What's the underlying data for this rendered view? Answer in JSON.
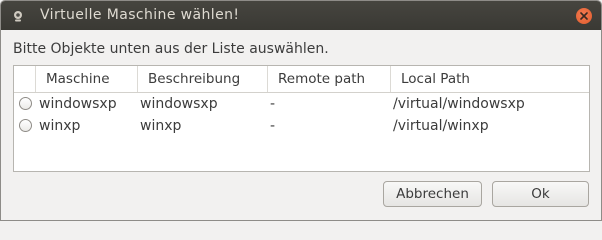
{
  "window": {
    "title": "Virtuelle Maschine wählen!",
    "app_icon": "vm-app-icon",
    "close_icon": "close-icon"
  },
  "instruction": "Bitte Objekte unten aus der Liste auswählen.",
  "table": {
    "columns": [
      "Maschine",
      "Beschreibung",
      "Remote path",
      "Local Path"
    ],
    "rows": [
      {
        "selected": false,
        "machine": "windowsxp",
        "description": "windowsxp",
        "remote_path": "-",
        "local_path": "/virtual/windowsxp"
      },
      {
        "selected": false,
        "machine": "winxp",
        "description": "winxp",
        "remote_path": "-",
        "local_path": "/virtual/winxp"
      }
    ]
  },
  "buttons": {
    "cancel": "Abbrechen",
    "ok": "Ok"
  },
  "colors": {
    "titlebar": "#3f3e39",
    "close_button": "#e8643a",
    "window_bg": "#f2f1f0"
  }
}
